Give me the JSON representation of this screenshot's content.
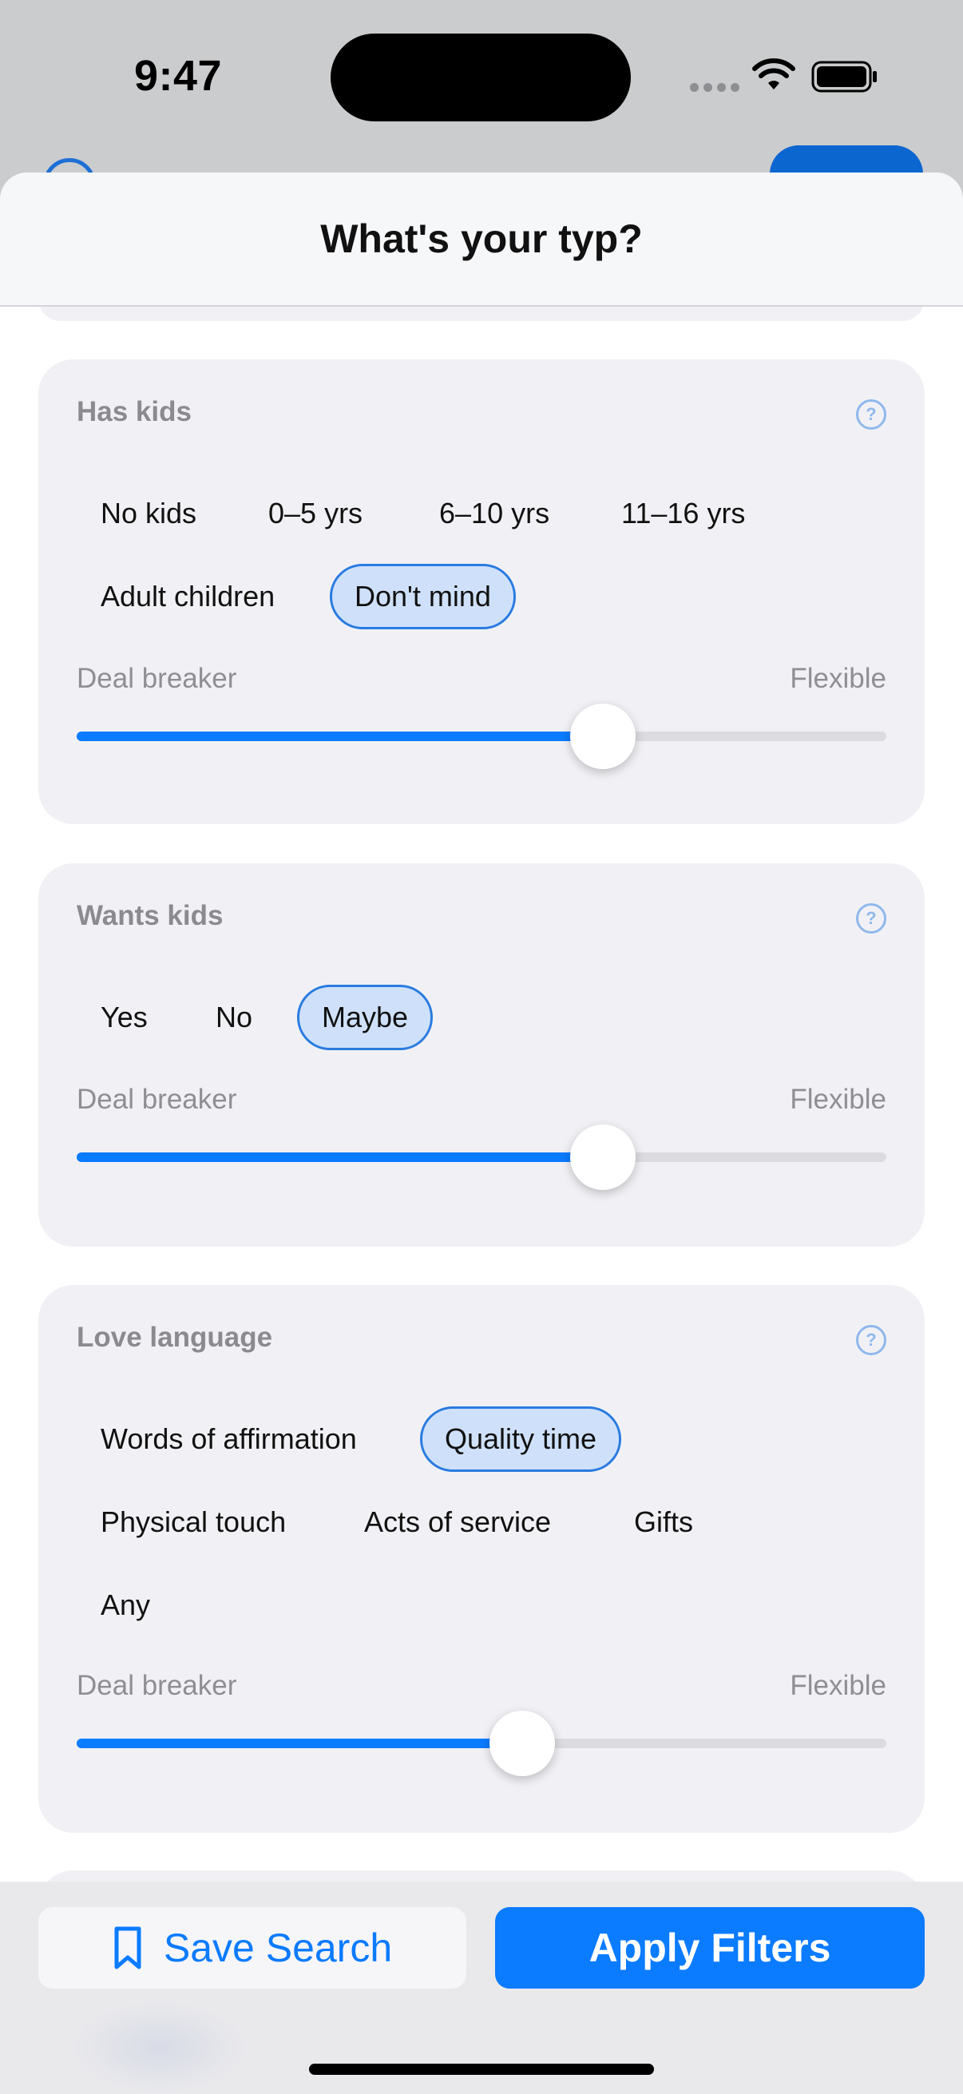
{
  "status": {
    "time": "9:47"
  },
  "sheet": {
    "title": "What's your typ?"
  },
  "sections": {
    "has_kids": {
      "title": "Has kids",
      "options": [
        "No kids",
        "0–5 yrs",
        "6–10 yrs",
        "11–16 yrs",
        "Adult children",
        "Don't mind"
      ],
      "selected": "Don't mind",
      "scale_left": "Deal breaker",
      "scale_right": "Flexible",
      "flexibility": 0.65
    },
    "wants_kids": {
      "title": "Wants kids",
      "options": [
        "Yes",
        "No",
        "Maybe"
      ],
      "selected": "Maybe",
      "scale_left": "Deal breaker",
      "scale_right": "Flexible",
      "flexibility": 0.65
    },
    "love_language": {
      "title": "Love language",
      "options": [
        "Words of affirmation",
        "Quality time",
        "Physical touch",
        "Acts of service",
        "Gifts",
        "Any"
      ],
      "selected": "Quality time",
      "scale_left": "Deal breaker",
      "scale_right": "Flexible",
      "flexibility": 0.55
    }
  },
  "help_glyph": "?",
  "footer": {
    "save_label": "Save Search",
    "apply_label": "Apply Filters"
  },
  "colors": {
    "accent": "#0b7bff",
    "selected_chip_bg": "#cfe1fa",
    "card_bg": "#f1f1f5"
  },
  "icons": [
    "wifi-icon",
    "battery-icon",
    "help-icon",
    "bookmark-icon"
  ]
}
